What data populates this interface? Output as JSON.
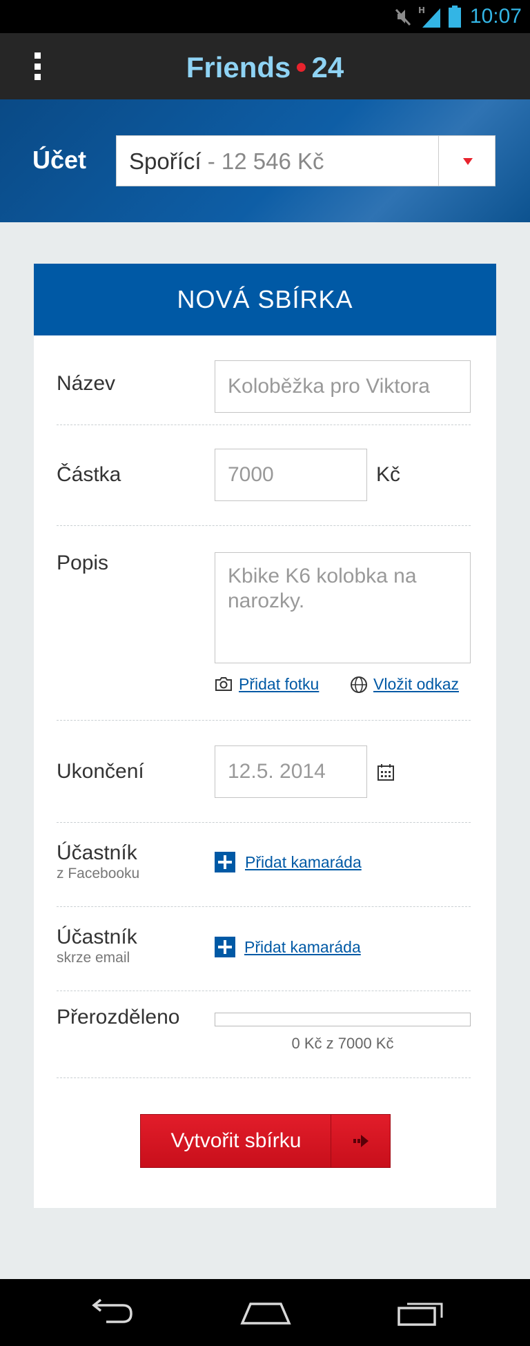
{
  "status_bar": {
    "time": "10:07",
    "network_label": "H",
    "icons": [
      "mute-icon",
      "signal-icon",
      "battery-icon"
    ]
  },
  "app_bar": {
    "brand_name": "Friends",
    "brand_number": "24",
    "menu_icon": "overflow-menu-icon"
  },
  "account": {
    "label": "Účet",
    "selected_name": "Spořící",
    "selected_separator": "-",
    "selected_balance": "12 546 Kč"
  },
  "form": {
    "title": "NOVÁ SBÍRKA",
    "name": {
      "label": "Název",
      "value": "Koloběžka pro Viktora"
    },
    "amount": {
      "label": "Částka",
      "value": "7000",
      "currency": "Kč"
    },
    "description": {
      "label": "Popis",
      "value": "Kbike K6 kolobka na narozky.",
      "add_photo_label": "Přidat fotku",
      "insert_link_label": "Vložit odkaz"
    },
    "end_date": {
      "label": "Ukončení",
      "value": "12.5. 2014"
    },
    "participant_facebook": {
      "label": "Účastník",
      "sublabel": "z Facebooku",
      "action_label": "Přidat kamaráda"
    },
    "participant_email": {
      "label": "Účastník",
      "sublabel": "skrze email",
      "action_label": "Přidat kamaráda"
    },
    "distributed": {
      "label": "Přerozděleno",
      "summary": "0 Kč z 7000 Kč",
      "fraction": 0
    },
    "submit_label": "Vytvořit sbírku"
  },
  "colors": {
    "primary_blue": "#0059a5",
    "accent_red": "#e21d2a",
    "brand_light_blue": "#8fd3f4",
    "status_blue": "#33b5e5"
  }
}
